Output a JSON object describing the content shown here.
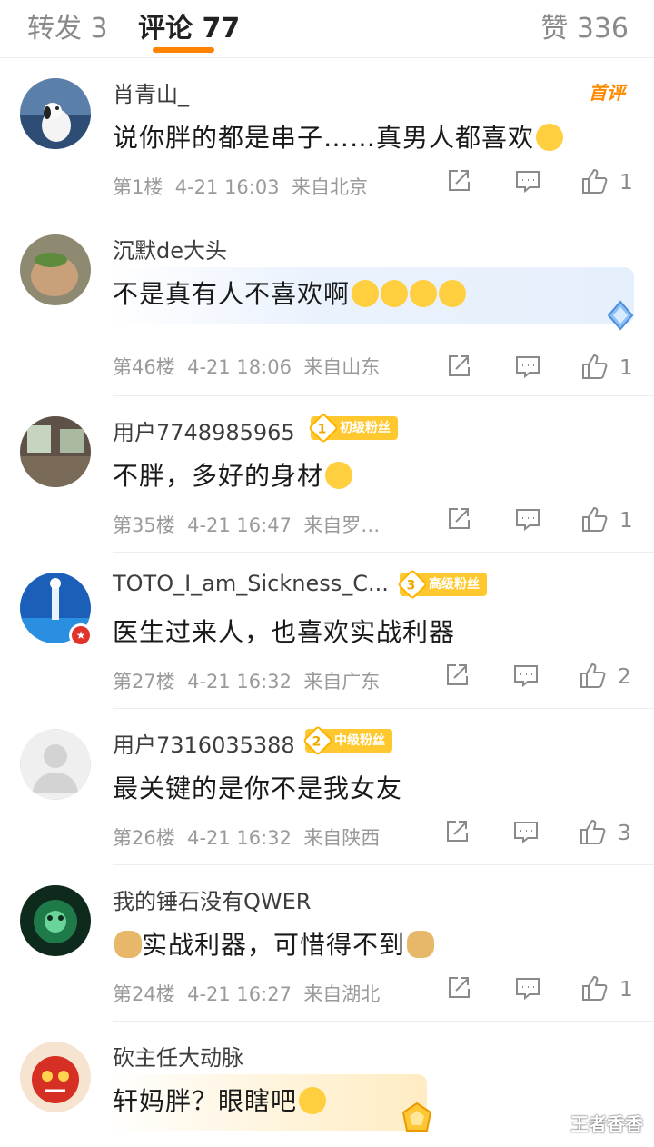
{
  "tabs": {
    "repost": "转发 3",
    "comments": "评论 77",
    "likes": "赞 336"
  },
  "comments": [
    {
      "user": "肖青山_",
      "first_badge": "首评",
      "text": "说你胖的都是串子……真男人都喜欢",
      "floor": "第1楼",
      "time": "4-21 16:03",
      "location": "来自北京",
      "likes": "1"
    },
    {
      "user": "沉默de大头",
      "text": "不是真有人不喜欢啊",
      "floor": "第46楼",
      "time": "4-21 18:06",
      "location": "来自山东",
      "likes": "1"
    },
    {
      "user": "用户7748985965",
      "fan_level": "1",
      "fan_label": "初级粉丝",
      "text": "不胖，多好的身材",
      "floor": "第35楼",
      "time": "4-21 16:47",
      "location": "来自罗…",
      "likes": "1"
    },
    {
      "user": "TOTO_I_am_Sickness_C...",
      "fan_level": "3",
      "fan_label": "高级粉丝",
      "text": "医生过来人，也喜欢实战利器",
      "floor": "第27楼",
      "time": "4-21 16:32",
      "location": "来自广东",
      "likes": "2"
    },
    {
      "user": "用户7316035388",
      "fan_level": "2",
      "fan_label": "中级粉丝",
      "text": "最关键的是你不是我女友",
      "floor": "第26楼",
      "time": "4-21 16:32",
      "location": "来自陕西",
      "likes": "3"
    },
    {
      "user": "我的锤石没有QWER",
      "text": "实战利器，可惜得不到",
      "floor": "第24楼",
      "time": "4-21 16:27",
      "location": "来自湖北",
      "likes": "1"
    },
    {
      "user": "砍主任大动脉",
      "text": "轩妈胖？眼瞎吧"
    }
  ],
  "watermark": "王者香香",
  "icons": [
    "share-icon",
    "reply-icon",
    "like-icon"
  ],
  "colors": {
    "accent": "#ff8200",
    "fan_badge": "#ffc82e",
    "meta": "#9a9a9a"
  }
}
